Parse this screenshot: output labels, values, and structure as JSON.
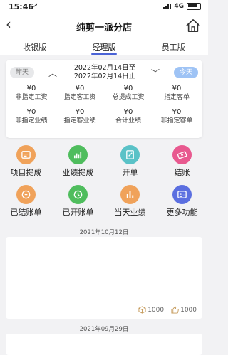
{
  "status": {
    "time": "15:46",
    "network": "4G"
  },
  "nav": {
    "title": "纯剪一派分店"
  },
  "tabs": [
    {
      "label": "收银版"
    },
    {
      "label": "经理版"
    },
    {
      "label": "员工版"
    }
  ],
  "filter": {
    "yesterday": "昨天",
    "today": "今天",
    "start": "2022年02月14日至",
    "end": "2022年02月14日止"
  },
  "stats": [
    {
      "value": "¥0",
      "label": "非指定工资"
    },
    {
      "value": "¥0",
      "label": "指定客工资"
    },
    {
      "value": "¥0",
      "label": "总提成工资"
    },
    {
      "value": "¥0",
      "label": "指定客单"
    },
    {
      "value": "¥0",
      "label": "非指定业绩"
    },
    {
      "value": "¥0",
      "label": "指定客业绩"
    },
    {
      "value": "¥0",
      "label": "合计业绩"
    },
    {
      "value": "¥0",
      "label": "非指定客单"
    }
  ],
  "menu": [
    {
      "label": "项目提成",
      "icon": "project-commission-icon",
      "color": "#f0a25a"
    },
    {
      "label": "业绩提成",
      "icon": "performance-commission-icon",
      "color": "#4fbd5d"
    },
    {
      "label": "开单",
      "icon": "create-order-icon",
      "color": "#5ac2c7"
    },
    {
      "label": "结账",
      "icon": "checkout-icon",
      "color": "#e8598f"
    },
    {
      "label": "已结账单",
      "icon": "settled-bills-icon",
      "color": "#f0a25a"
    },
    {
      "label": "已开账单",
      "icon": "opened-bills-icon",
      "color": "#4fbd5d"
    },
    {
      "label": "当天业绩",
      "icon": "daily-performance-icon",
      "color": "#f0a25a"
    },
    {
      "label": "更多功能",
      "icon": "more-functions-icon",
      "color": "#5b6fe0"
    }
  ],
  "records": [
    {
      "date": "2021年10月12日",
      "count": "1000",
      "likes": "1000"
    },
    {
      "date": "2021年09月29日"
    }
  ]
}
